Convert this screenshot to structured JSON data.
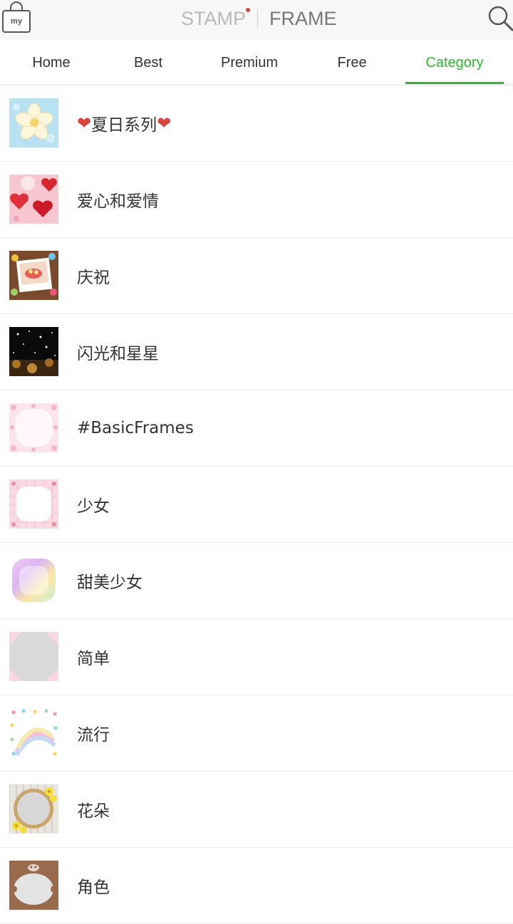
{
  "header": {
    "my_label": "my",
    "title_left": "STAMP",
    "title_right": "FRAME"
  },
  "tabs": [
    {
      "label": "Home"
    },
    {
      "label": "Best"
    },
    {
      "label": "Premium"
    },
    {
      "label": "Free"
    },
    {
      "label": "Category",
      "active": true
    }
  ],
  "accent_color": "#2fb52f",
  "badge_color": "#e8402e",
  "categories": [
    {
      "label": "夏日系列",
      "icon": "summer-flower-thumbnail",
      "decorations": [
        "❤",
        "❤"
      ]
    },
    {
      "label": "爱心和爱情",
      "icon": "hearts-thumbnail"
    },
    {
      "label": "庆祝",
      "icon": "celebration-photo-thumbnail"
    },
    {
      "label": "闪光和星星",
      "icon": "sparkles-thumbnail"
    },
    {
      "label": "#BasicFrames",
      "icon": "pink-heart-frame-thumbnail"
    },
    {
      "label": "少女",
      "icon": "pink-grid-frame-thumbnail"
    },
    {
      "label": "甜美少女",
      "icon": "pastel-rainbow-thumbnail"
    },
    {
      "label": "简单",
      "icon": "simple-frame-thumbnail"
    },
    {
      "label": "流行",
      "icon": "pop-rainbow-frame-thumbnail"
    },
    {
      "label": "花朵",
      "icon": "flower-wreath-thumbnail"
    },
    {
      "label": "角色",
      "icon": "character-frame-thumbnail"
    }
  ]
}
